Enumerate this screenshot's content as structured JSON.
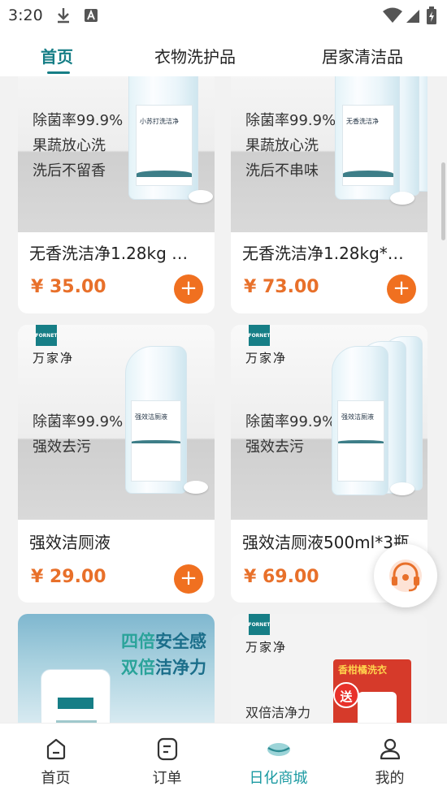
{
  "status_bar": {
    "time": "3:20"
  },
  "top_tabs": [
    {
      "label": "首页",
      "active": true
    },
    {
      "label": "衣物洗护品",
      "active": false
    },
    {
      "label": "居家清洁品",
      "active": false
    }
  ],
  "products": [
    {
      "title": "无香洗洁净1.28kg …",
      "price": "¥ 35.00",
      "image_lines": [
        "除菌率99.9%",
        "果蔬放心洗",
        "洗后不留香"
      ],
      "bottle_label": "小苏打洗洁净"
    },
    {
      "title": "无香洗洁净1.28kg*…",
      "price": "¥ 73.00",
      "image_lines": [
        "除菌率99.9%",
        "果蔬放心洗",
        "洗后不串味"
      ],
      "bottle_label": "无香洗洁净"
    },
    {
      "title": "强效洁厕液",
      "price": "¥ 29.00",
      "image_lines": [
        "除菌率99.9%",
        "强效去污"
      ],
      "bottle_label": "强效洁厕液"
    },
    {
      "title": "强效洁厕液500ml*3瓶",
      "price": "¥ 69.00",
      "image_lines": [
        "除菌率99.9%",
        "强效去污"
      ],
      "bottle_label": "强效洁厕液"
    }
  ],
  "brand_mark": {
    "logo": "FORNET",
    "handwriting": "万家净"
  },
  "promo_cards": [
    {
      "line1_accent": "四倍",
      "line1_rest": "安全感",
      "line2_accent": "双倍",
      "line2_rest": "洁净力"
    },
    {
      "caption": "双倍洁净力",
      "gift_badge": "送",
      "box_text": "香柑橘洗衣"
    }
  ],
  "bottom_nav": [
    {
      "label": "首页",
      "icon": "home-icon",
      "active": false
    },
    {
      "label": "订单",
      "icon": "order-icon",
      "active": false
    },
    {
      "label": "日化商城",
      "icon": "mall-icon",
      "active": true
    },
    {
      "label": "我的",
      "icon": "profile-icon",
      "active": false
    }
  ],
  "colors": {
    "brand_teal": "#167e86",
    "price_orange": "#e8702a",
    "add_button": "#f07020",
    "nav_active": "#1b9aa2"
  }
}
